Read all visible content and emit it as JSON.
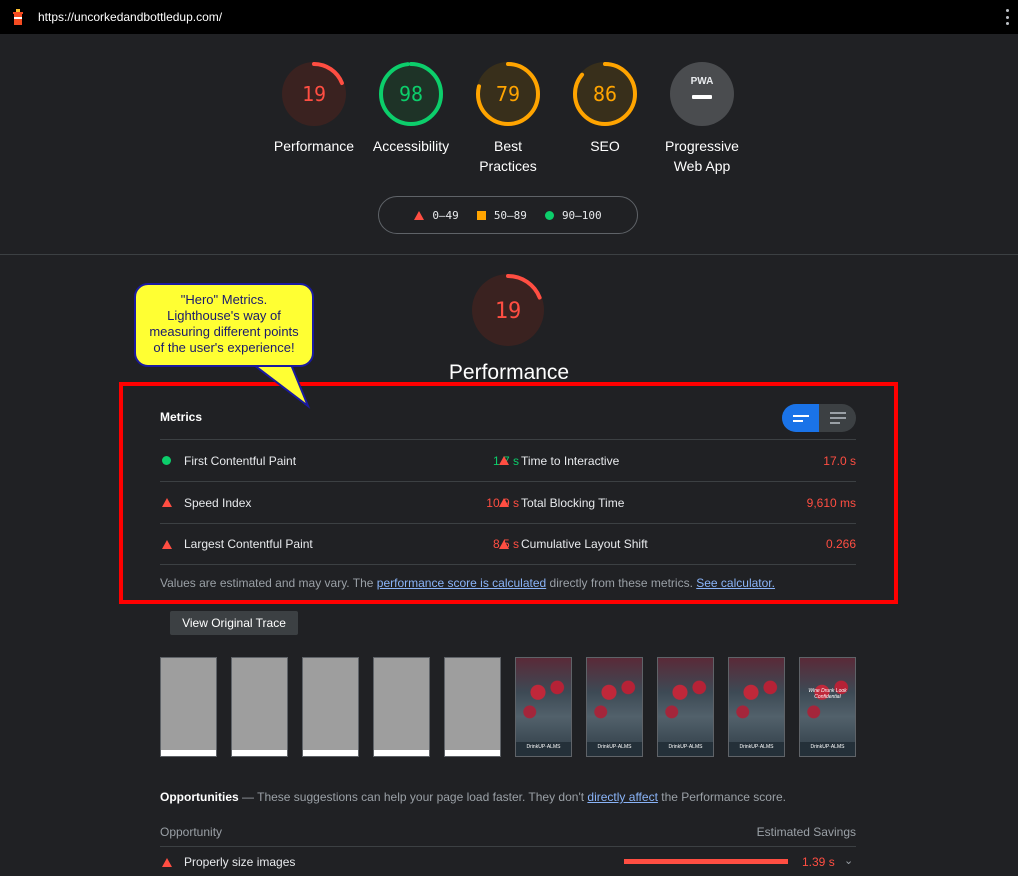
{
  "topbar": {
    "url": "https://uncorkedandbottledup.com/",
    "logo": "lighthouse-icon",
    "menu_icon": "kebab-menu-icon"
  },
  "categories": [
    {
      "score": "19",
      "label": "Performance",
      "color": "#ff4e42",
      "fraction": 0.19
    },
    {
      "score": "98",
      "label": "Accessibility",
      "color": "#0cce6b",
      "fraction": 0.98
    },
    {
      "score": "79",
      "label": "Best Practices",
      "color": "#ffa400",
      "fraction": 0.79
    },
    {
      "score": "86",
      "label": "SEO",
      "color": "#ffa400",
      "fraction": 0.86
    },
    {
      "score": "PWA",
      "label": "Progressive Web App",
      "color": "#9aa0a6"
    }
  ],
  "legend": {
    "fail": "0–49",
    "average": "50–89",
    "pass": "90–100"
  },
  "perf": {
    "score": "19",
    "title": "Performance",
    "fraction": 0.19,
    "color": "#ff4e42"
  },
  "callout": {
    "line1": "\"Hero\" Metrics.",
    "line2": "Lighthouse's way of",
    "line3": "measuring different points",
    "line4": "of the user's experience!"
  },
  "metrics": {
    "header": "Metrics",
    "left": [
      {
        "name": "First Contentful Paint",
        "value": "1.7 s",
        "status": "pass"
      },
      {
        "name": "Speed Index",
        "value": "10.9 s",
        "status": "fail"
      },
      {
        "name": "Largest Contentful Paint",
        "value": "8.5 s",
        "status": "fail"
      }
    ],
    "right": [
      {
        "name": "Time to Interactive",
        "value": "17.0 s",
        "status": "fail"
      },
      {
        "name": "Total Blocking Time",
        "value": "9,610 ms",
        "status": "fail"
      },
      {
        "name": "Cumulative Layout Shift",
        "value": "0.266",
        "status": "fail"
      }
    ],
    "note_pre": "Values are estimated and may vary. The ",
    "note_link1": "performance score is calculated",
    "note_mid": " directly from these metrics. ",
    "note_link2": "See calculator."
  },
  "trace_button": "View Original Trace",
  "filmstrip": {
    "blank_frames": 5,
    "image_frames": 5,
    "last_frame_title": "Wine Drunk Look Confidential",
    "footer_text": "DrinkUP·ALMS"
  },
  "opportunities": {
    "title": "Opportunities",
    "desc_pre": " — These suggestions can help your page load faster. They don't ",
    "desc_link": "directly affect",
    "desc_post": " the Performance score.",
    "col_left": "Opportunity",
    "col_right": "Estimated Savings",
    "items": [
      {
        "name": "Properly size images",
        "savings": "1.39 s",
        "status": "fail"
      }
    ]
  }
}
